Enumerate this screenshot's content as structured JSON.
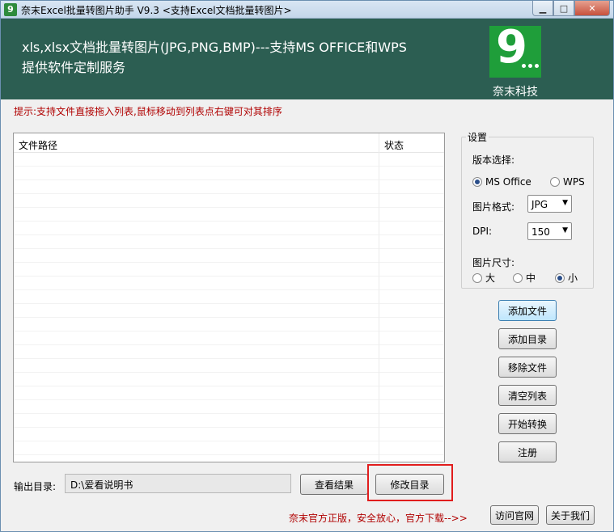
{
  "window": {
    "title": "奈末Excel批量转图片助手 V9.3 <支持Excel文档批量转图片>",
    "app_icon": "9"
  },
  "banner": {
    "line1": "xls,xlsx文档批量转图片(JPG,PNG,BMP)---支持MS OFFICE和WPS",
    "line2": "提供软件定制服务",
    "company": "奈末科技",
    "logo_digit": "9",
    "bg_color": "#2c5e52",
    "logo_color": "#1f9e3a"
  },
  "tip": "提示:支持文件直接拖入列表,鼠标移动到列表点右键可对其排序",
  "list": {
    "col_path": "文件路径",
    "col_status": "状态"
  },
  "settings": {
    "title": "设置",
    "version_label": "版本选择:",
    "version_options": [
      "MS Office",
      "WPS"
    ],
    "version_selected": "MS Office",
    "format_label": "图片格式:",
    "format_value": "JPG",
    "dpi_label": "DPI:",
    "dpi_value": "150",
    "size_label": "图片尺寸:",
    "size_options": [
      "大",
      "中",
      "小"
    ],
    "size_selected": "小"
  },
  "buttons": {
    "add_file": "添加文件",
    "add_dir": "添加目录",
    "remove_file": "移除文件",
    "clear_list": "清空列表",
    "start": "开始转换",
    "register": "注册",
    "view_result": "查看结果",
    "change_dir": "修改目录",
    "visit_site": "访问官网",
    "about": "关于我们"
  },
  "output": {
    "label": "输出目录:",
    "path": "D:\\爱看说明书"
  },
  "promo": "奈末官方正版，安全放心，官方下载-->>",
  "colors": {
    "tip": "#b00000",
    "highlight": "#e11d1d"
  }
}
